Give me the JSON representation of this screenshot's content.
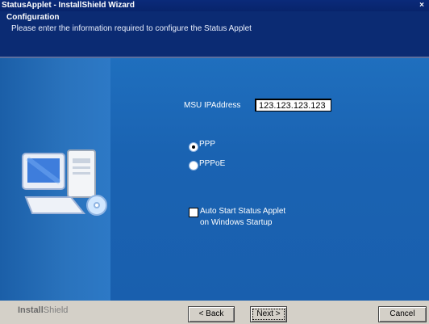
{
  "window": {
    "title": "StatusApplet - InstallShield Wizard"
  },
  "header": {
    "title": "Configuration",
    "subtitle": "Please enter the information required to configure the Status Applet"
  },
  "form": {
    "ip_label": "MSU IPAddress",
    "ip_value": "123.123.123.123",
    "radio_ppp": "PPP",
    "radio_pppoe": "PPPoE",
    "selected": "PPP",
    "autostart_line1": "Auto Start Status Applet",
    "autostart_line2": "on Windows Startup",
    "autostart_checked": false
  },
  "footer": {
    "brand_a": "Install",
    "brand_b": "Shield",
    "back": "< Back",
    "next": "Next >",
    "cancel": "Cancel"
  },
  "icons": [
    "close-icon",
    "computer-icon"
  ]
}
